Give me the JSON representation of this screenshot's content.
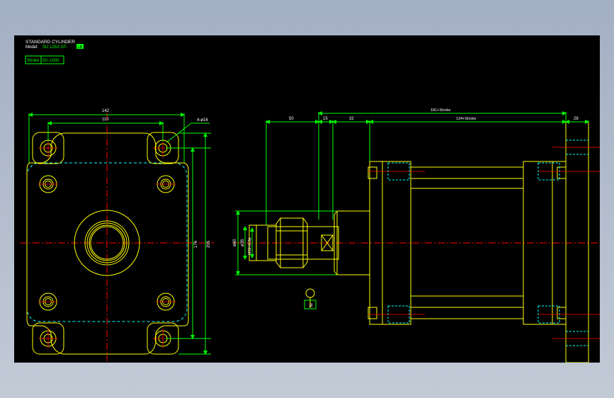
{
  "title_block": {
    "title": "STANDARD CYLINDER",
    "model_label": "Model:",
    "model_value": "SU 125X-ST-",
    "model_badge": "LB",
    "stroke_label": "Stroke",
    "stroke_value": "50~1000"
  },
  "front_view": {
    "dim_width_outer": "142",
    "dim_width_inner": "110",
    "dim_holes": "4-ø16",
    "dim_height_inner": "176",
    "dim_height_outer": "205"
  },
  "side_view": {
    "dim_50": "50",
    "dim_15": "15",
    "dim_32": "32",
    "dim_total": "181+Stroke",
    "dim_body": "134+Stroke",
    "dim_28": "28",
    "dim_dia60": "ø60",
    "dim_dia35": "ø35",
    "dim_thread": "M32×2.0p",
    "dim_wrench": "32"
  },
  "colors": {
    "background": "#000000",
    "outline": "#ffff00",
    "dimension": "#00ff00",
    "centerline": "#ff0000",
    "hidden": "#00ffff",
    "text": "#ffffff"
  }
}
